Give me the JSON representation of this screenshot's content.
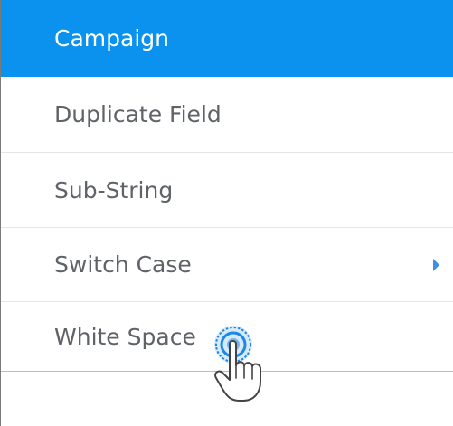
{
  "menu": {
    "items": [
      {
        "label": "Campaign",
        "selected": true,
        "has_submenu": false
      },
      {
        "label": "Duplicate Field",
        "selected": false,
        "has_submenu": false
      },
      {
        "label": "Sub-String",
        "selected": false,
        "has_submenu": false
      },
      {
        "label": "Switch Case",
        "selected": false,
        "has_submenu": true
      },
      {
        "label": "White Space",
        "selected": false,
        "has_submenu": false
      }
    ],
    "submenu_icon": "chevron-right-icon",
    "cursor_icon": "hand-pointer-icon"
  },
  "colors": {
    "selected_bg": "#0b92ee",
    "selected_text": "#ffffff",
    "item_text": "#5f6368",
    "arrow": "#3f8fe6",
    "click_ripple": "#1e88e5"
  }
}
